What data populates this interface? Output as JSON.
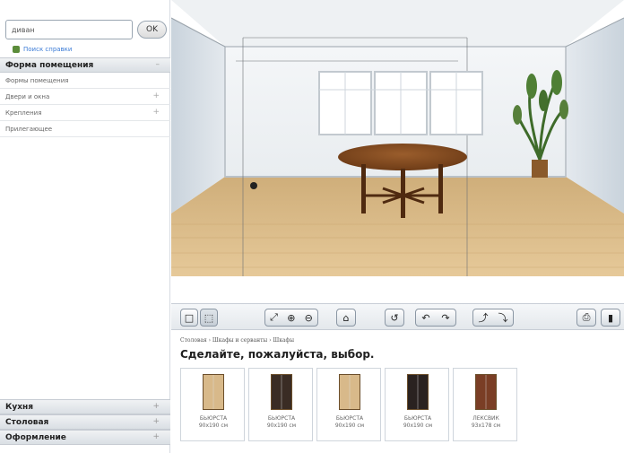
{
  "search": {
    "value": "диван",
    "ok_label": "OK"
  },
  "help": {
    "label": "Поиск справки",
    "icon": "help-icon"
  },
  "sidebar": {
    "room_section": {
      "label": "Форма помещения",
      "toggle": "–"
    },
    "items": [
      {
        "label": "Формы помещения",
        "toggle": ""
      },
      {
        "label": "Двери и окна",
        "toggle": "+"
      },
      {
        "label": "Крепления",
        "toggle": "+"
      },
      {
        "label": "Прилегающее",
        "toggle": ""
      }
    ],
    "bottom_sections": [
      {
        "label": "Кухня",
        "toggle": "+"
      },
      {
        "label": "Столовая",
        "toggle": "+"
      },
      {
        "label": "Оформление",
        "toggle": "+"
      }
    ]
  },
  "toolbar": {
    "buttons": [
      {
        "name": "2d-view-icon",
        "glyph": "□"
      },
      {
        "name": "3d-view-icon",
        "glyph": "⬚"
      },
      {
        "name": "fit-view-icon",
        "glyph": "⤢"
      },
      {
        "name": "zoom-in-icon",
        "glyph": "⊕"
      },
      {
        "name": "zoom-out-icon",
        "glyph": "⊖"
      },
      {
        "name": "walk-icon",
        "glyph": "⌂"
      },
      {
        "name": "rotate-icon",
        "glyph": "↺"
      },
      {
        "name": "orbit-left-icon",
        "glyph": "↶"
      },
      {
        "name": "orbit-right-icon",
        "glyph": "↷"
      },
      {
        "name": "tilt-up-icon",
        "glyph": "⤴"
      },
      {
        "name": "tilt-down-icon",
        "glyph": "⤵"
      },
      {
        "name": "print-icon",
        "glyph": "⎙"
      },
      {
        "name": "delete-icon",
        "glyph": "▮"
      }
    ]
  },
  "catalog": {
    "breadcrumb": "Столовая › Шкафы и серванты › Шкафы",
    "title": "Сделайте, пожалуйста, выбор.",
    "products": [
      {
        "name": "БЬЮРСТА",
        "size": "90x190 см",
        "color": "#d8b98a"
      },
      {
        "name": "БЬЮРСТА",
        "size": "90x190 см",
        "color": "#3a2c24"
      },
      {
        "name": "БЬЮРСТА",
        "size": "90x190 см",
        "color": "#d8b98a"
      },
      {
        "name": "БЬЮРСТА",
        "size": "90x190 см",
        "color": "#2a2220"
      },
      {
        "name": "ЛЕКСВИК",
        "size": "93x178 см",
        "color": "#7a3e25"
      }
    ]
  }
}
